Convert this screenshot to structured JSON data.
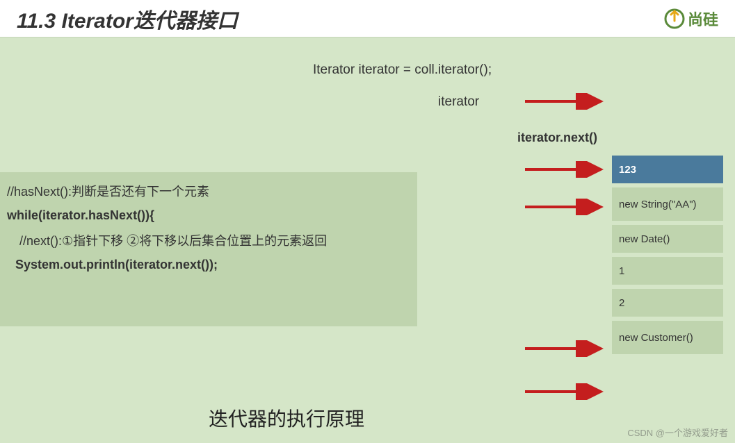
{
  "header": {
    "title": "11.3 Iterator迭代器接口",
    "logo_text": "尚硅"
  },
  "top_code": "Iterator iterator = coll.iterator();",
  "iterator_label": "iterator",
  "iterator_next": "iterator.next()",
  "code_box": {
    "line1": "//hasNext():判断是否还有下一个元素",
    "line2": "while(iterator.hasNext()){",
    "line3": "//next():①指针下移 ②将下移以后集合位置上的元素返回",
    "line4": "System.out.println(iterator.next());"
  },
  "list": {
    "items": [
      "123",
      "new String(\"AA\")",
      "new Date()",
      "1",
      "2",
      "new Customer()"
    ]
  },
  "bottom_title": "迭代器的执行原理",
  "watermark": "CSDN @一个游戏爱好者"
}
